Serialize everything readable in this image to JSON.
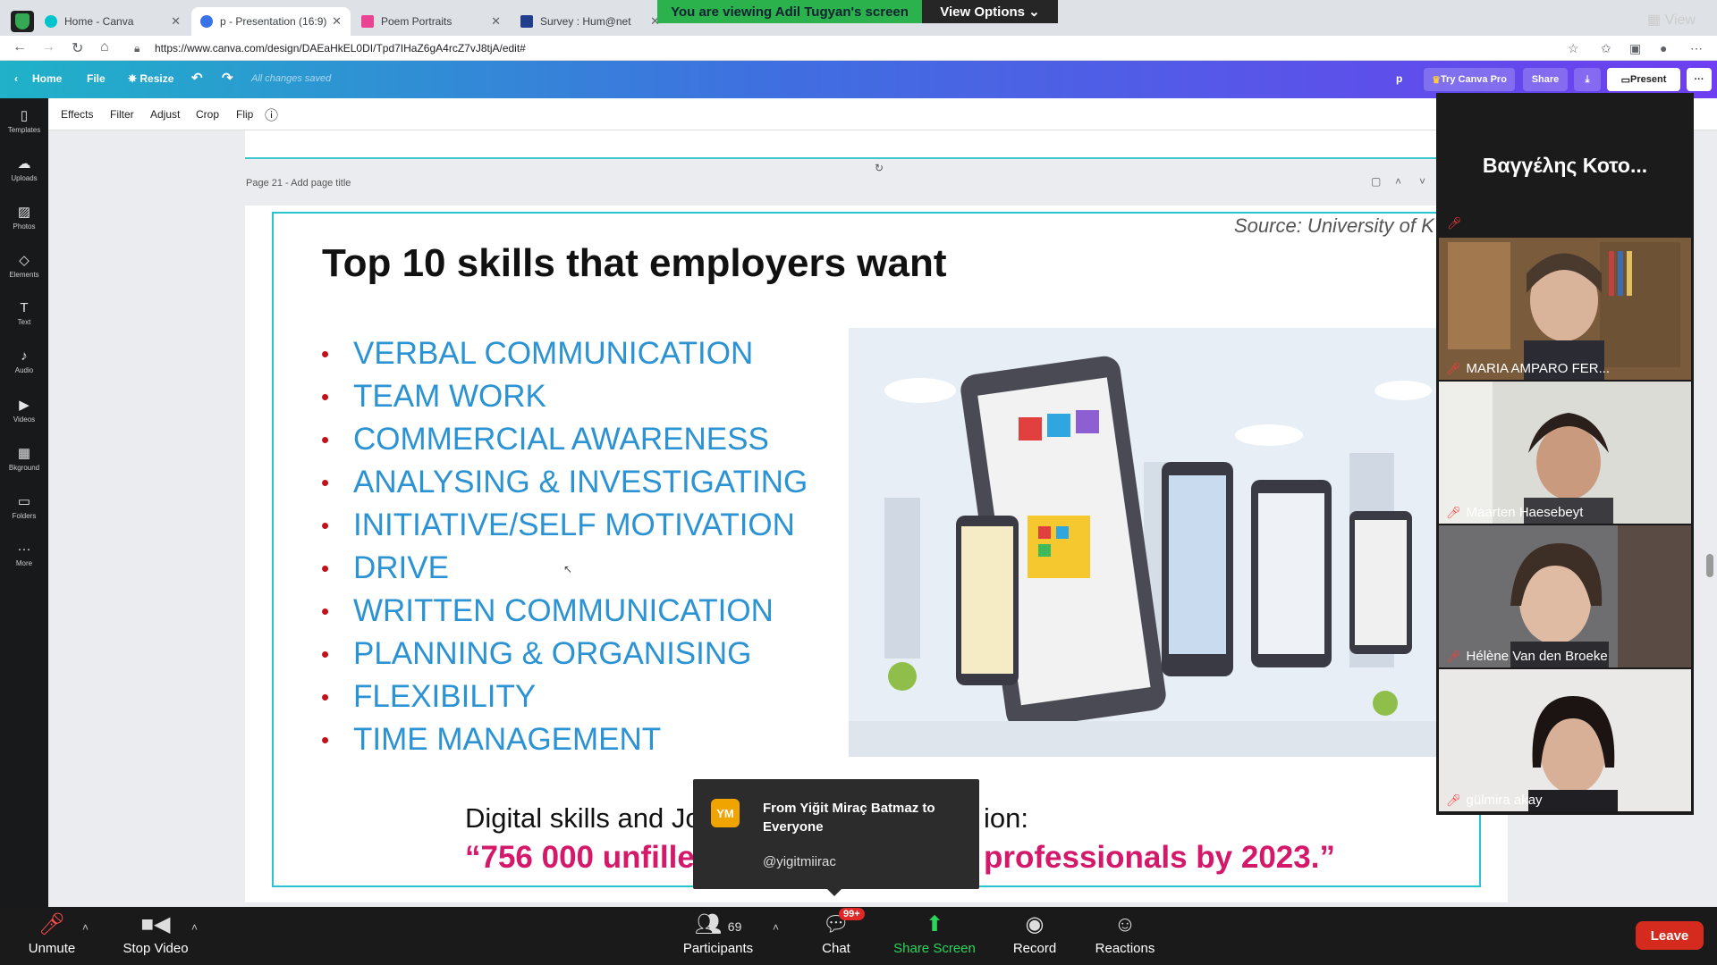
{
  "browser": {
    "tabs": [
      {
        "label": "Home - Canva",
        "color": "#00c4cc"
      },
      {
        "label": "p - Presentation (16:9)",
        "color": "#3b72e8"
      },
      {
        "label": "Poem Portraits",
        "color": "#e94393"
      },
      {
        "label": "Survey : Hum@net",
        "color": "#223d8e"
      }
    ],
    "url": "https://www.canva.com/design/DAEaHkEL0DI/Tpd7IHaZ6gA4rcZ7vJ8tjA/edit#"
  },
  "zoom_banner": {
    "viewing": "You are viewing Adil Tugyan's screen",
    "view_options": "View Options ⌄",
    "view_top": "View"
  },
  "canva": {
    "header": {
      "home": "Home",
      "file": "File",
      "resize": "Resize",
      "saved": "All changes saved",
      "user_initial": "p",
      "try_pro": "Try Canva Pro",
      "share": "Share",
      "present": "Present"
    },
    "sidebar": [
      {
        "label": "Templates",
        "icon": "templates-icon",
        "glyph": "▯"
      },
      {
        "label": "Uploads",
        "icon": "upload-icon",
        "glyph": "☁"
      },
      {
        "label": "Photos",
        "icon": "photo-icon",
        "glyph": "▨"
      },
      {
        "label": "Elements",
        "icon": "elements-icon",
        "glyph": "◇"
      },
      {
        "label": "Text",
        "icon": "text-icon",
        "glyph": "T"
      },
      {
        "label": "Audio",
        "icon": "audio-icon",
        "glyph": "♪"
      },
      {
        "label": "Videos",
        "icon": "video-icon",
        "glyph": "▶"
      },
      {
        "label": "Bkground",
        "icon": "background-icon",
        "glyph": "▦"
      },
      {
        "label": "Folders",
        "icon": "folder-icon",
        "glyph": "▭"
      },
      {
        "label": "More",
        "icon": "more-icon",
        "glyph": "···"
      }
    ],
    "toolbar": [
      "Effects",
      "Filter",
      "Adjust",
      "Crop",
      "Flip"
    ],
    "page_label": "Page 21 - Add page title"
  },
  "slide": {
    "source": "Source: University of K",
    "title": "Top 10 skills that employers want",
    "skills": [
      "VERBAL COMMUNICATION",
      "TEAM WORK",
      "COMMERCIAL AWARENESS",
      "ANALYSING & INVESTIGATING",
      "INITIATIVE/SELF MOTIVATION",
      "DRIVE",
      "WRITTEN COMMUNICATION",
      "PLANNING & ORGANISING",
      "FLEXIBILITY",
      "TIME MANAGEMENT"
    ],
    "bottom_line": "Digital skills and Jo",
    "bottom_line_end": "ion:",
    "quote_start": "“756 000 unfille",
    "quote_end": "professionals by 2023.”"
  },
  "chat_popup": {
    "initials": "YM",
    "from": "From Yiğit Miraç Batmaz to Everyone",
    "message": "@yigitmiirac"
  },
  "participants_panel": {
    "active_speaker": "Βαγγέλης Κοτο...",
    "videos": [
      {
        "name": "MARIA AMPARO FER..."
      },
      {
        "name": "Maarten Haesebeyt"
      },
      {
        "name": "Hélène Van den Broeke"
      },
      {
        "name": "gülmira akay"
      }
    ]
  },
  "zoom_bar": {
    "unmute": "Unmute",
    "stop_video": "Stop Video",
    "participants": "Participants",
    "participants_count": "69",
    "chat": "Chat",
    "chat_badge": "99+",
    "share_screen": "Share Screen",
    "record": "Record",
    "reactions": "Reactions",
    "leave": "Leave"
  }
}
